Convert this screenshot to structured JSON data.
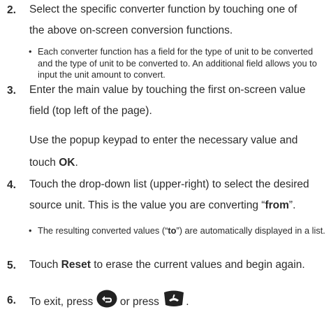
{
  "steps": [
    {
      "number": "2.",
      "line1": "Select the specific converter function by touching one of",
      "line2": "the above on-screen conversion functions.",
      "bullet": "Each converter function has a field for the type of unit to be converted and the type of unit to be converted to. An additional field allows you to input the unit amount to convert."
    },
    {
      "number": "3.",
      "line1": "Enter the main value by touching the first on-screen value",
      "line2": "field (top left of the page).",
      "para_line1": "Use the popup keypad to enter the necessary value and",
      "para_line2_pre": "touch ",
      "para_line2_bold": "OK",
      "para_line2_post": "."
    },
    {
      "number": "4.",
      "line1": "Touch the drop-down list (upper-right) to select the desired",
      "line2_pre": "source unit. This is the value you are converting “",
      "line2_bold": "from",
      "line2_post": "”.",
      "bullet_pre": "The resulting converted values (“",
      "bullet_bold": "to",
      "bullet_post": "”) are automatically displayed in a list."
    },
    {
      "number": "5.",
      "pre": "Touch ",
      "bold": "Reset",
      "post": " to erase the current values and begin again."
    },
    {
      "number": "6.",
      "pre": "To exit, press ",
      "mid": " or press ",
      "post": ".",
      "back_icon": "back-key-icon",
      "end_icon": "end-call-key-icon"
    }
  ],
  "bullet_char": "•"
}
